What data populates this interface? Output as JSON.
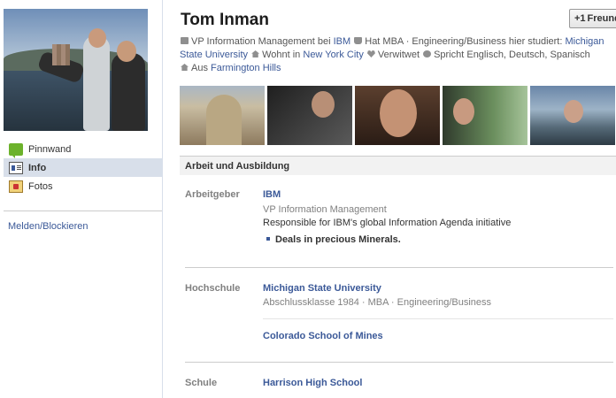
{
  "profile": {
    "name": "Tom Inman",
    "friend_button_label": "Freund"
  },
  "info_bar": {
    "job_prefix": "VP Information Management bei",
    "job_company": "IBM",
    "degree_prefix": "Hat MBA · Engineering/Business hier studiert:",
    "school": "Michigan State University",
    "lives_prefix": "Wohnt in",
    "city": "New York City",
    "relationship": "Verwitwet",
    "languages": "Spricht Englisch, Deutsch, Spanisch",
    "from_prefix": "Aus",
    "hometown": "Farmington Hills"
  },
  "left_nav": {
    "items": [
      {
        "label": "Pinnwand",
        "icon": "wall-icon"
      },
      {
        "label": "Info",
        "icon": "info-icon"
      },
      {
        "label": "Fotos",
        "icon": "photos-icon"
      }
    ],
    "report_link": "Melden/Blockieren"
  },
  "section": {
    "title": "Arbeit und Ausbildung"
  },
  "employer": {
    "label": "Arbeitgeber",
    "name": "IBM",
    "position": "VP Information Management",
    "description": "Responsible for IBM's global Information Agenda initiative",
    "bullet": "Deals in precious Minerals."
  },
  "college": {
    "label": "Hochschule",
    "school1": "Michigan State University",
    "school1_detail": "Abschlussklasse 1984 · MBA · Engineering/Business",
    "school2": "Colorado School of Mines"
  },
  "highschool": {
    "label": "Schule",
    "name": "Harrison High School"
  }
}
